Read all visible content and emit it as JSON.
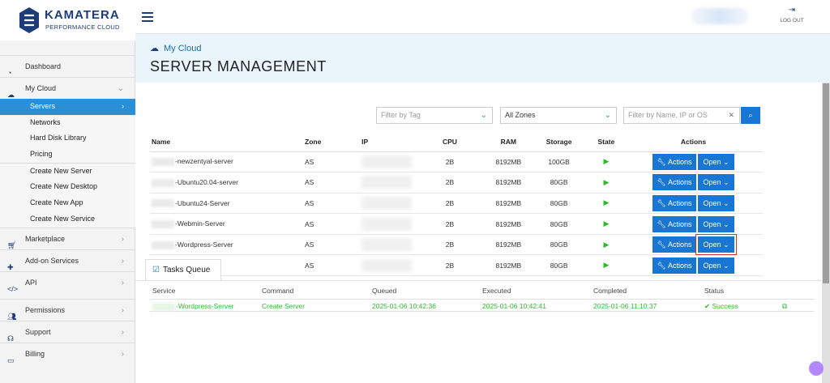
{
  "logo": {
    "name": "KAMATERA",
    "subtitle": "PERFORMANCE CLOUD"
  },
  "topbar": {
    "logout_label": "LOG OUT"
  },
  "sidebar": {
    "items": [
      {
        "label": "Dashboard",
        "icon": "dashboard-icon"
      },
      {
        "label": "My Cloud",
        "icon": "cloud-icon"
      },
      {
        "label": "Marketplace",
        "icon": "cart-icon"
      },
      {
        "label": "Add-on Services",
        "icon": "puzzle-icon"
      },
      {
        "label": "API",
        "icon": "code-icon"
      },
      {
        "label": "Permissions",
        "icon": "users-icon"
      },
      {
        "label": "Support",
        "icon": "headset-icon"
      },
      {
        "label": "Billing",
        "icon": "card-icon"
      }
    ],
    "cloud_sub": [
      "Servers",
      "Networks",
      "Hard Disk Library",
      "Pricing"
    ],
    "create_sub": [
      "Create New Server",
      "Create New Desktop",
      "Create New App",
      "Create New Service"
    ]
  },
  "header": {
    "breadcrumb": "My Cloud",
    "title": "SERVER MANAGEMENT"
  },
  "filters": {
    "tag_placeholder": "Filter by Tag",
    "zone_value": "All Zones",
    "search_placeholder": "Filter by Name, IP or OS"
  },
  "table": {
    "headers": [
      "Name",
      "Zone",
      "IP",
      "CPU",
      "RAM",
      "Storage",
      "State",
      "Actions"
    ],
    "rows": [
      {
        "name": "-newzentyal-server",
        "zone": "AS",
        "cpu": "2B",
        "ram": "8192MB",
        "storage": "100GB"
      },
      {
        "name": "-Ubuntu20.04-server",
        "zone": "AS",
        "cpu": "2B",
        "ram": "8192MB",
        "storage": "80GB"
      },
      {
        "name": "-Ubuntu24-Server",
        "zone": "AS",
        "cpu": "2B",
        "ram": "8192MB",
        "storage": "80GB"
      },
      {
        "name": "-Webmin-Server",
        "zone": "AS",
        "cpu": "2B",
        "ram": "8192MB",
        "storage": "80GB"
      },
      {
        "name": "-Wordpress-Server",
        "zone": "AS",
        "cpu": "2B",
        "ram": "8192MB",
        "storage": "80GB"
      },
      {
        "name": "",
        "zone": "AS",
        "cpu": "2B",
        "ram": "8192MB",
        "storage": "80GB"
      }
    ],
    "actions_label": "Actions",
    "open_label": "Open"
  },
  "tasks": {
    "tab_label": "Tasks Queue",
    "headers": [
      "Service",
      "Command",
      "Queued",
      "Executed",
      "Completed",
      "Status"
    ],
    "rows": [
      {
        "service": "-Wordpress-Server",
        "command": "Create Server",
        "queued": "2025-01-06 10:42:36",
        "executed": "2025-01-06 10:42:41",
        "completed": "2025-01-06 11:10:37",
        "status": "Success"
      }
    ]
  },
  "colors": {
    "brand": "#1c3d7a",
    "accent": "#1976d2",
    "success": "#2db82d",
    "highlight": "#d9302f"
  }
}
